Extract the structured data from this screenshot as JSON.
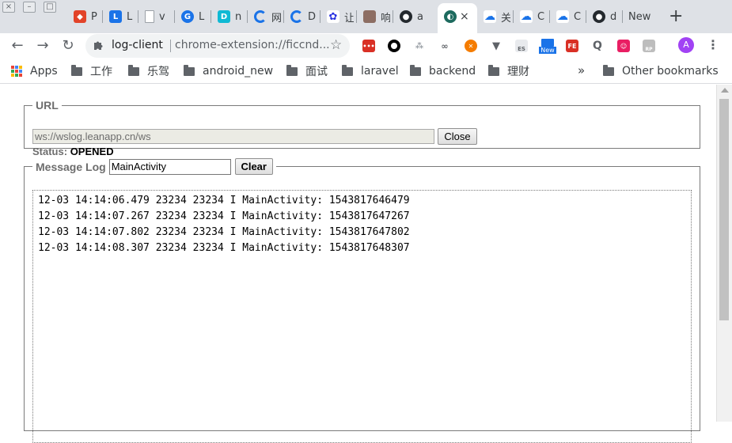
{
  "tabs": [
    {
      "title": "P",
      "icon": "gitlab-icon",
      "color": "#e24329"
    },
    {
      "title": "L",
      "icon": "letter-l-icon",
      "color": "#1a73e8"
    },
    {
      "title": "v",
      "icon": "document-icon",
      "color": "#9aa0a6"
    },
    {
      "title": "L",
      "icon": "globe-blue-icon",
      "color": "#1a73e8"
    },
    {
      "title": "n",
      "icon": "letter-d-icon",
      "color": "#0fb9d4"
    },
    {
      "title": "网",
      "icon": "spinner-icon",
      "color": "#1a73e8"
    },
    {
      "title": "D",
      "icon": "spinner-icon",
      "color": "#1a73e8"
    },
    {
      "title": "让",
      "icon": "baidu-icon",
      "color": "#2932e1"
    },
    {
      "title": "响",
      "icon": "avatar-thumb-icon",
      "color": "#8d6e63"
    },
    {
      "title": "a",
      "icon": "github-icon",
      "color": "#24292e"
    },
    {
      "title": "×",
      "icon": "leancloud-icon",
      "color": "#1d6a5e",
      "active": true
    },
    {
      "title": "关",
      "icon": "cloud-icon",
      "color": "#1a73e8"
    },
    {
      "title": "C",
      "icon": "cloud-icon",
      "color": "#1a73e8"
    },
    {
      "title": "C",
      "icon": "cloud-icon",
      "color": "#1a73e8"
    },
    {
      "title": "d",
      "icon": "github-icon",
      "color": "#24292e"
    },
    {
      "title": "New",
      "icon": "none",
      "color": "#5f6368"
    }
  ],
  "toolbar": {
    "extension_name": "log-client",
    "url": "chrome-extension://ficcnd...",
    "avatar_letter": "A",
    "new_badge": "New",
    "fe_badge": "FE",
    "es_label": "ES",
    "rp_label": "RP"
  },
  "bookmarks": {
    "apps": "Apps",
    "folders": [
      "工作",
      "乐驾",
      "android_new",
      "面试",
      "laravel",
      "backend",
      "理财"
    ],
    "other": "Other bookmarks"
  },
  "url_section": {
    "legend": "URL",
    "ws_url": "ws://wslog.leanapp.cn/ws",
    "close_label": "Close",
    "status_label": "Status:",
    "status_value": "OPENED"
  },
  "log_section": {
    "legend": "Message Log",
    "filter_value": "MainActivity",
    "clear_label": "Clear",
    "lines": [
      "12-03 14:14:06.479 23234 23234 I MainActivity: 1543817646479",
      "12-03 14:14:07.267 23234 23234 I MainActivity: 1543817647267",
      "12-03 14:14:07.802 23234 23234 I MainActivity: 1543817647802",
      "12-03 14:14:08.307 23234 23234 I MainActivity: 1543817648307"
    ]
  }
}
